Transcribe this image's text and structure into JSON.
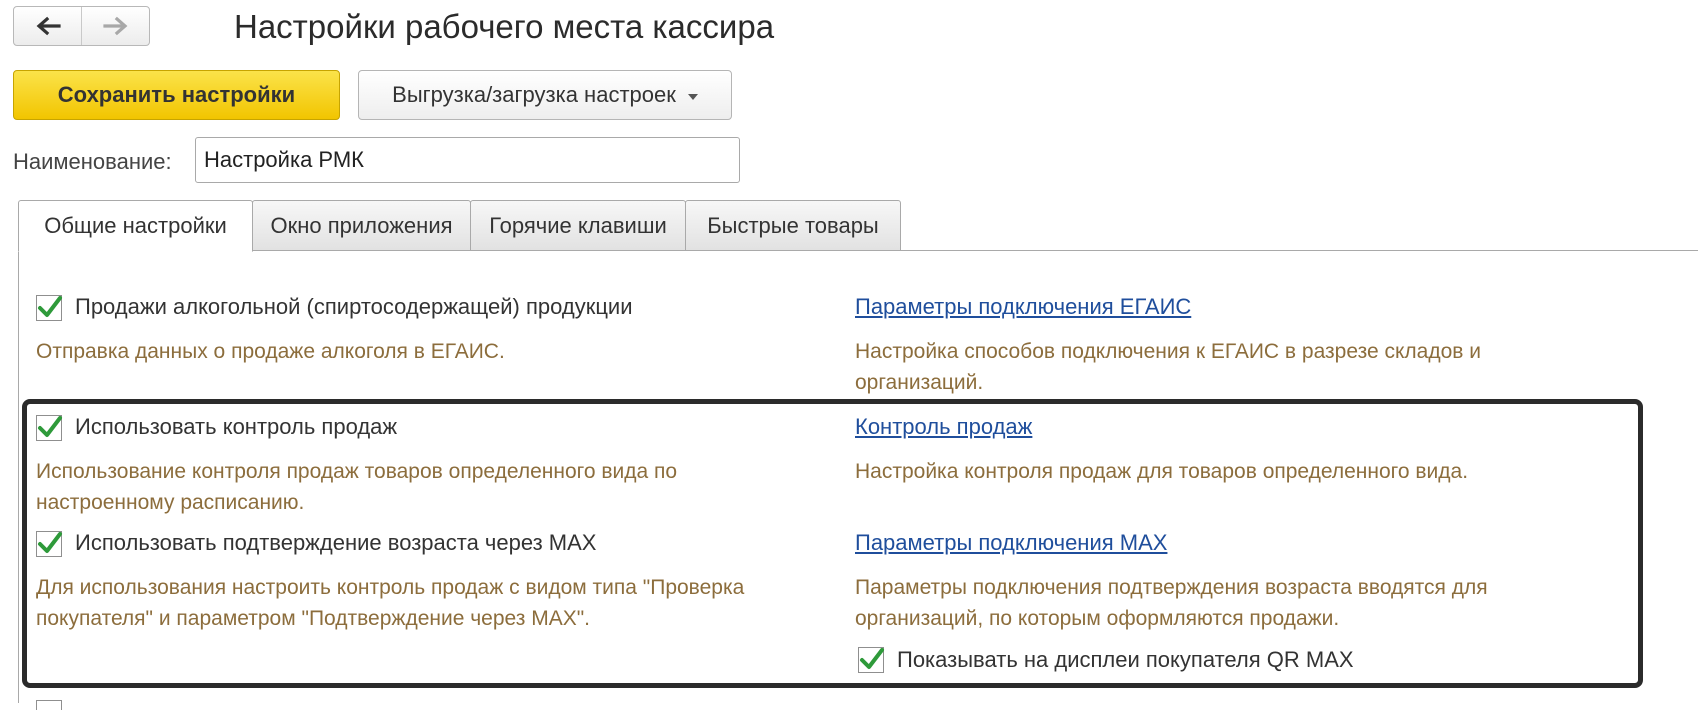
{
  "window": {
    "title": "Настройки рабочего места кассира"
  },
  "toolbar": {
    "back_icon": "arrow-left-icon",
    "forward_icon": "arrow-right-icon",
    "save_label": "Сохранить настройки",
    "export_label": "Выгрузка/загрузка настроек",
    "accent_color": "#f5cd0f"
  },
  "name_field": {
    "label": "Наименование:",
    "value": "Настройка РМК"
  },
  "tabs": [
    {
      "label": "Общие настройки",
      "active": true
    },
    {
      "label": "Окно приложения",
      "active": false
    },
    {
      "label": "Горячие клавиши",
      "active": false
    },
    {
      "label": "Быстрые товары",
      "active": false
    }
  ],
  "settings": {
    "alcohol": {
      "checked": true,
      "label": "Продажи алкогольной (спиртосодержащей) продукции",
      "desc": "Отправка данных о продаже алкоголя в ЕГАИС.",
      "link": "Параметры подключения ЕГАИС",
      "link_desc": "Настройка способов подключения к ЕГАИС в разрезе складов и организаций."
    },
    "sales_control": {
      "checked": true,
      "label": "Использовать контроль продаж",
      "desc": "Использование контроля продаж товаров определенного вида по настроенному расписанию.",
      "link": "Контроль продаж",
      "link_desc": "Настройка контроля продаж для товаров определенного вида."
    },
    "age_check": {
      "checked": true,
      "label": "Использовать подтверждение возраста через MAX",
      "desc": "Для использования настроить контроль продаж с видом типа \"Проверка покупателя\" и параметром \"Подтверждение через MAX\".",
      "link": "Параметры подключения MAX",
      "link_desc": "Параметры подключения подтверждения возраста вводятся для организаций, по которым оформляются продажи."
    },
    "qr_display": {
      "checked": true,
      "label": "Показывать на дисплеи покупателя QR MAX"
    }
  },
  "colors": {
    "description_text": "#8c6d3c",
    "link_text": "#1f4e9c",
    "check_mark": "#2e9a3a",
    "highlight_frame": "#2b2b2b"
  }
}
